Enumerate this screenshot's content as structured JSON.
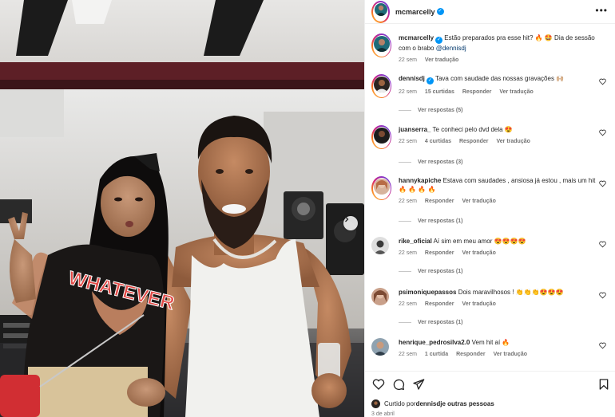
{
  "post": {
    "author": "mcmarcelly",
    "caption": "Estão preparados pra esse hit? 🔥 🤩 Dia de sessão com o brabo ",
    "caption_mention": "@dennisdj",
    "time": "22 sem",
    "translate": "Ver tradução"
  },
  "photo": {
    "shirt_text": "WHATEVER"
  },
  "comments": [
    {
      "user": "dennisdj",
      "verified": true,
      "text": "Tava com saudade das nossas gravações 🙌🏼",
      "time": "22 sem",
      "likes": "15 curtidas",
      "reply": "Responder",
      "translate": "Ver tradução",
      "replies": "Ver respostas (5)"
    },
    {
      "user": "juanserra_",
      "verified": false,
      "text": "Te conheci pelo dvd dela 😍",
      "time": "22 sem",
      "likes": "4 curtidas",
      "reply": "Responder",
      "translate": "Ver tradução",
      "replies": "Ver respostas (3)"
    },
    {
      "user": "hannykapiche",
      "verified": false,
      "text": "Estava com saudades , ansiosa já estou , mais um hit 🔥 🔥 🔥 🔥",
      "time": "22 sem",
      "likes": "",
      "reply": "Responder",
      "translate": "Ver tradução",
      "replies": "Ver respostas (1)"
    },
    {
      "user": "rike_oficial",
      "verified": false,
      "text": "Aí sim em meu amor 😍😍😍😍",
      "time": "22 sem",
      "likes": "",
      "reply": "Responder",
      "translate": "Ver tradução",
      "replies": "Ver respostas (1)"
    },
    {
      "user": "psimoniquepassos",
      "verified": false,
      "text": "Dois maravilhosos ! 👏👏👏😍😍😍",
      "time": "22 sem",
      "likes": "",
      "reply": "Responder",
      "translate": "Ver tradução",
      "replies": "Ver respostas (1)"
    },
    {
      "user": "henrique_pedrosilva2.0",
      "verified": false,
      "text": "Vem hit aí 🔥",
      "time": "22 sem",
      "likes": "1 curtida",
      "reply": "Responder",
      "translate": "Ver tradução",
      "replies": ""
    }
  ],
  "footer": {
    "liked_prefix": "Curtido por ",
    "liked_user": "dennisdj",
    "liked_suffix": " e outras pessoas",
    "date": "3 de abril"
  },
  "icons": {
    "heart": "heart-icon",
    "comment": "comment-icon",
    "share": "share-icon",
    "save": "bookmark-icon",
    "more": "more-options-icon",
    "next": "chevron-right-icon"
  }
}
